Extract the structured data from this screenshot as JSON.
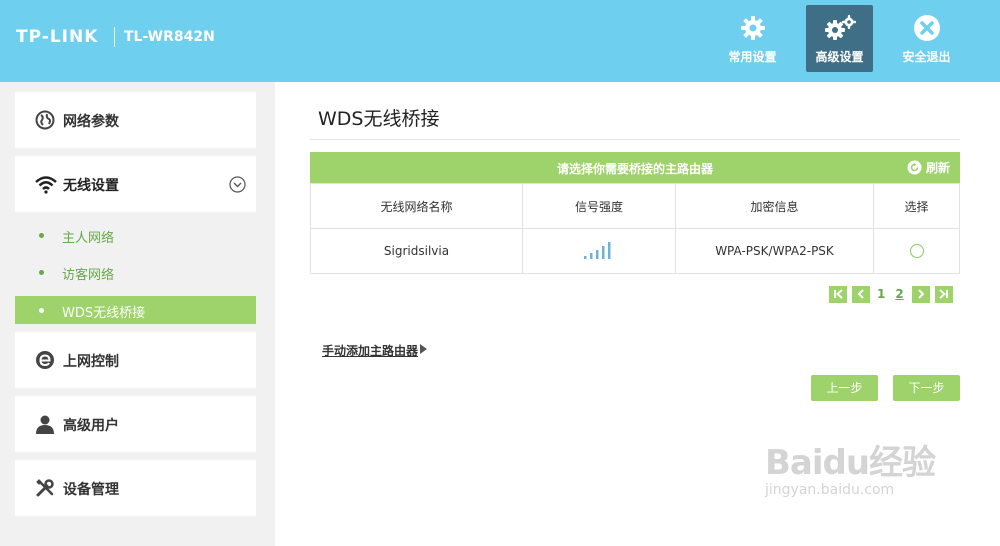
{
  "header": {
    "brand": "TP-LINK",
    "model": "TL-WR842N",
    "nav": [
      {
        "label": "常用设置",
        "icon": "gear-icon",
        "active": false
      },
      {
        "label": "高级设置",
        "icon": "gears-icon",
        "active": true
      },
      {
        "label": "安全退出",
        "icon": "close-icon",
        "active": false
      }
    ]
  },
  "sidebar": {
    "network_params": "网络参数",
    "wireless_settings": "无线设置",
    "sub_items": [
      "主人网络",
      "访客网络",
      "WDS无线桥接"
    ],
    "internet_control": "上网控制",
    "advanced_user": "高级用户",
    "device_mgmt": "设备管理"
  },
  "main": {
    "title": "WDS无线桥接",
    "table_title": "请选择你需要桥接的主路由器",
    "refresh": "刷新",
    "columns": [
      "无线网络名称",
      "信号强度",
      "加密信息",
      "选择"
    ],
    "rows": [
      {
        "ssid": "Sigridsilvia",
        "signal_icon": "signal-strength-icon",
        "encryption": "WPA-PSK/WPA2-PSK"
      }
    ],
    "pager": {
      "page1": "1",
      "page2": "2"
    },
    "manual_add": "手动添加主路由器",
    "prev": "上一步",
    "next": "下一步"
  },
  "watermark": {
    "main": "Baidu经验",
    "sub": "jingyan.baidu.com"
  },
  "colors": {
    "header": "#6fcfee",
    "accent_green": "#9ed26a",
    "active_nav": "#3f6f86"
  }
}
